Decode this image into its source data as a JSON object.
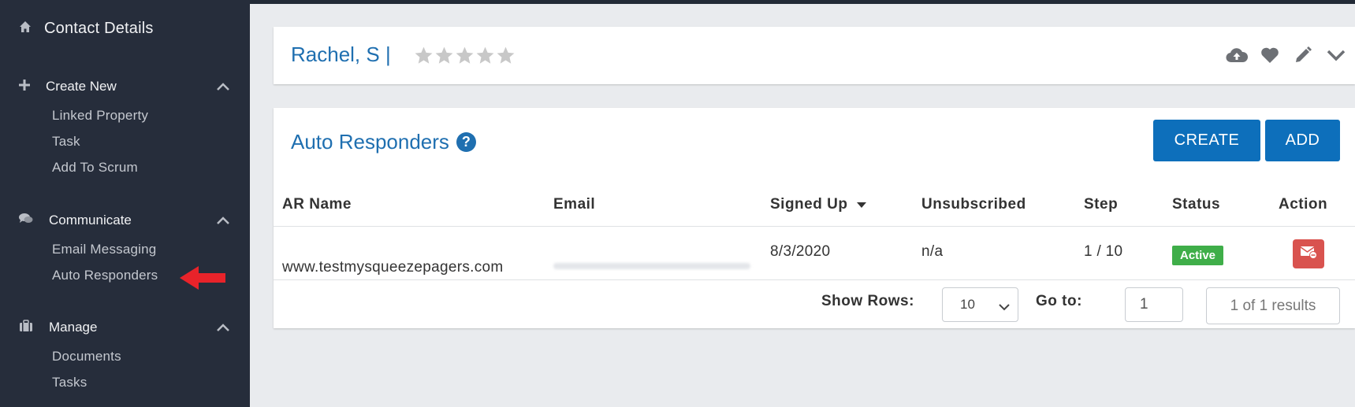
{
  "sidebar": {
    "title": "Contact Details",
    "sections": [
      {
        "label": "Create New",
        "icon": "plus-icon",
        "items": [
          "Linked Property",
          "Task",
          "Add To Scrum"
        ]
      },
      {
        "label": "Communicate",
        "icon": "chat-icon",
        "items": [
          "Email Messaging",
          "Auto Responders"
        ]
      },
      {
        "label": "Manage",
        "icon": "briefcase-icon",
        "items": [
          "Documents",
          "Tasks"
        ]
      }
    ]
  },
  "contact": {
    "name": "Rachel, S |",
    "rating": 0,
    "rating_max": 5,
    "icons": [
      "cloud-upload-icon",
      "heart-icon",
      "pencil-icon",
      "chevron-down-icon"
    ]
  },
  "auto_responders": {
    "title": "Auto Responders",
    "create_label": "CREATE",
    "add_label": "ADD",
    "columns": [
      "AR Name",
      "Email",
      "Signed Up",
      "Unsubscribed",
      "Step",
      "Status",
      "Action"
    ],
    "rows": [
      {
        "ar_name": "www.testmysqueezepagers.com",
        "email": "",
        "signed_up": "8/3/2020",
        "unsubscribed": "n/a",
        "step": "1 / 10",
        "status": "Active"
      }
    ],
    "pagination": {
      "show_rows_label": "Show Rows:",
      "rows_value": "10",
      "goto_label": "Go to:",
      "goto_value": "1",
      "results_text": "1 of 1 results"
    }
  },
  "colors": {
    "sidebar_bg": "#262d3b",
    "accent_blue": "#0d6fbb",
    "link_blue": "#1f6fb0",
    "status_green": "#3fae49",
    "action_red": "#d9534f",
    "arrow_red": "#e8232a"
  }
}
